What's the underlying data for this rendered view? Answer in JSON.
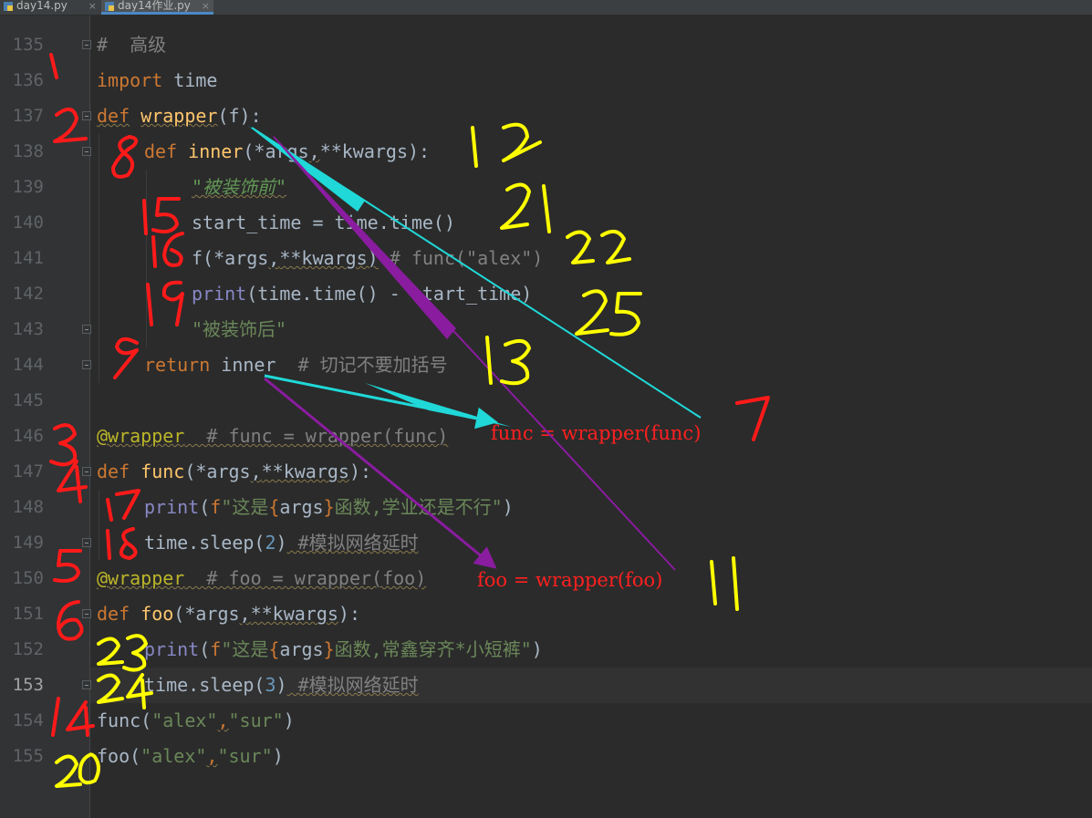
{
  "tabs": [
    {
      "label": "day14.py",
      "active": false,
      "close": "×"
    },
    {
      "label": "day14作业.py",
      "active": true,
      "close": "×"
    }
  ],
  "gutter": {
    "line_numbers": [
      "135",
      "136",
      "137",
      "138",
      "139",
      "140",
      "141",
      "142",
      "143",
      "144",
      "145",
      "146",
      "147",
      "148",
      "149",
      "150",
      "151",
      "152",
      "153",
      "154",
      "155"
    ],
    "current_line": "153"
  },
  "code": {
    "l135": {
      "comment": "#  高级"
    },
    "l136": {
      "kw": "import",
      "rest": " time"
    },
    "l137": {
      "kw": "def",
      "name": "wrapper",
      "rest": "(f):"
    },
    "l138": {
      "kw": "def",
      "name": "inner",
      "p1": "(*args",
      "p2": ",",
      "p3": "**kwargs):"
    },
    "l139": {
      "doc": "\"被装饰前\""
    },
    "l140": {
      "code": "start_time = time.time()"
    },
    "l141": {
      "call": "f(*args",
      "comma": ",",
      "call2": "**kwargs)",
      "comment": " # func(\"alex\")"
    },
    "l142": {
      "bi": "print",
      "rest": "(time.time() - start_time)"
    },
    "l143": {
      "str": "\"被装饰后\""
    },
    "l144": {
      "kw": "return",
      "rest": " inner  ",
      "comment": "# 切记不要加括号"
    },
    "l146": {
      "dec": "@wrapper",
      "comment": "  # func = wrapper(func)"
    },
    "l147": {
      "kw": "def",
      "name": "func",
      "p1": "(*args",
      "p2": ",",
      "p3": "**kwargs",
      "p4": "):"
    },
    "l148": {
      "bi": "print",
      "open": "(",
      "f": "f",
      "s1": "\"这是",
      "b1": "{",
      "v": "args",
      "b2": "}",
      "s2": "函数,学业还是不行\"",
      "close": ")"
    },
    "l149": {
      "code": "time.sleep(",
      "num": "2",
      "close": ")",
      "comment": " #模拟网络延时"
    },
    "l150": {
      "dec": "@wrapper",
      "comment": "  # foo = wrapper(foo)"
    },
    "l151": {
      "kw": "def",
      "name": "foo",
      "p1": "(*args",
      "p2": ",",
      "p3": "**kwargs",
      "p4": "):"
    },
    "l152": {
      "bi": "print",
      "open": "(",
      "f": "f",
      "s1": "\"这是",
      "b1": "{",
      "v": "args",
      "b2": "}",
      "s2": "函数,常鑫穿齐*小短裤\"",
      "close": ")"
    },
    "l153": {
      "code": "time.sleep(",
      "num": "3",
      "close": ")",
      "comment": " #模拟网络延时"
    },
    "l154": {
      "call": "func(",
      "s1": "\"alex\"",
      "comma": ",",
      "s2": "\"sur\"",
      "close": ")"
    },
    "l155": {
      "call": "foo(",
      "s1": "\"alex\"",
      "comma": ",",
      "s2": "\"sur\"",
      "close": ")"
    }
  },
  "annotations": {
    "red_notes": [
      "func = wrapper(func)",
      "foo = wrapper(foo)"
    ],
    "red_numbers": [
      "1",
      "2",
      "3",
      "4",
      "5",
      "6",
      "7",
      "8",
      "9",
      "14",
      "15",
      "16",
      "17",
      "18",
      "19",
      "20"
    ],
    "yellow_numbers": [
      "11",
      "12",
      "13",
      "21",
      "22",
      "23",
      "24",
      "25"
    ],
    "colors": {
      "red": "#ff1a1a",
      "yellow": "#ffff00",
      "cyan": "#20d8d8",
      "purple": "#8a1ca0"
    }
  }
}
